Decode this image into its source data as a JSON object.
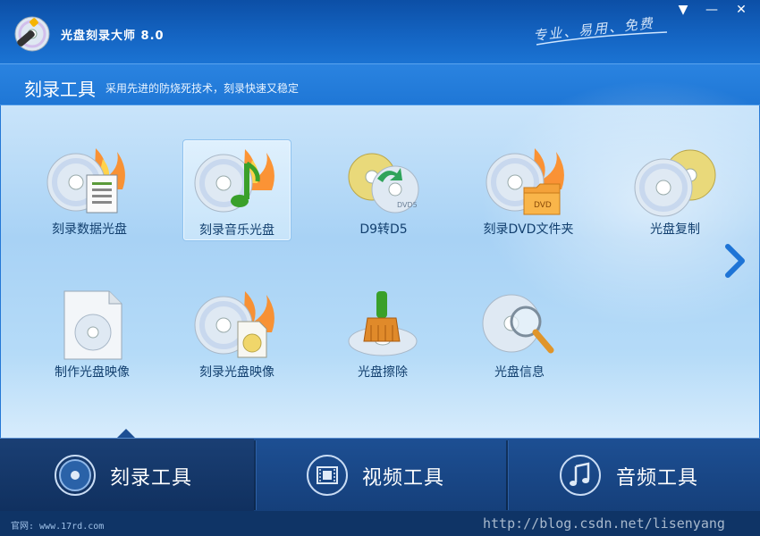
{
  "app": {
    "title": "光盘刻录大师 8.0",
    "slogan": "专业、易用、免费"
  },
  "window_controls": [
    "▼",
    "—",
    "✕"
  ],
  "section": {
    "title": "刻录工具",
    "subtitle": "采用先进的防烧死技术，刻录快速又稳定"
  },
  "tools": [
    {
      "label": "刻录数据光盘",
      "icon": "data-disc-icon"
    },
    {
      "label": "刻录音乐光盘",
      "icon": "music-disc-icon",
      "selected": true
    },
    {
      "label": "D9转D5",
      "icon": "d9-to-d5-icon"
    },
    {
      "label": "刻录DVD文件夹",
      "icon": "dvd-folder-icon"
    },
    {
      "label": "光盘复制",
      "icon": "disc-copy-icon"
    },
    {
      "label": "制作光盘映像",
      "icon": "make-image-icon"
    },
    {
      "label": "刻录光盘映像",
      "icon": "burn-image-icon"
    },
    {
      "label": "光盘擦除",
      "icon": "disc-erase-icon"
    },
    {
      "label": "光盘信息",
      "icon": "disc-info-icon"
    }
  ],
  "tabs": [
    {
      "label": "刻录工具",
      "icon": "disc-icon",
      "active": true
    },
    {
      "label": "视频工具",
      "icon": "film-icon"
    },
    {
      "label": "音频工具",
      "icon": "music-note-icon"
    }
  ],
  "status": {
    "site": "官网: www.17rd.com",
    "watermark": "http://blog.csdn.net/lisenyang"
  },
  "colors": {
    "title_bar": "#1464c2",
    "content_bg": "#a8d2f5",
    "tab_bar": "#153f7a",
    "label_text": "#13406f"
  }
}
